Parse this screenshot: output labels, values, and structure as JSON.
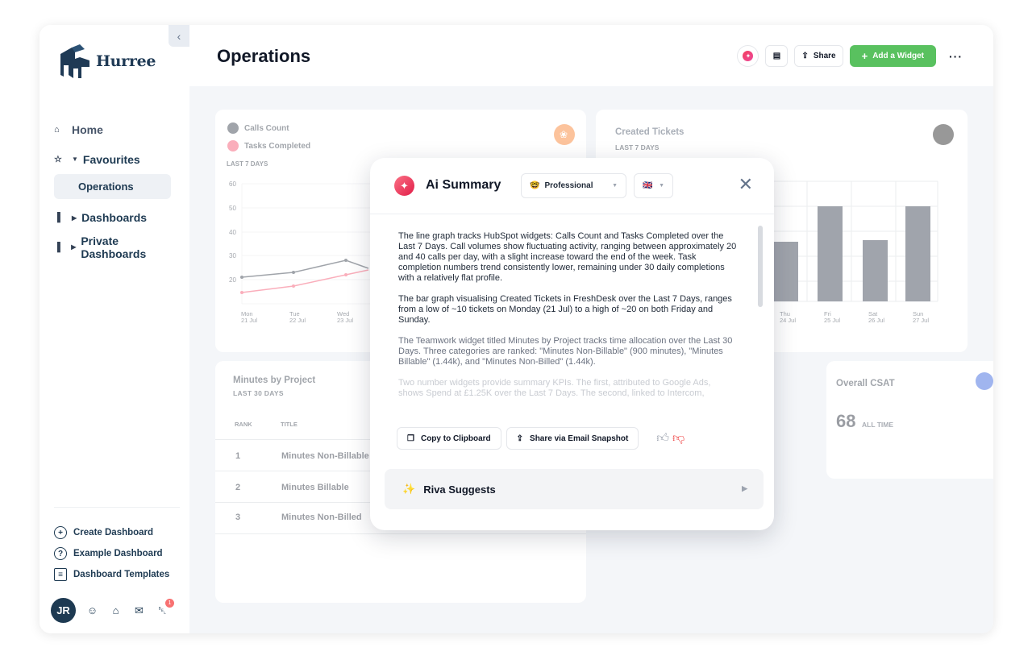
{
  "sidebar": {
    "logo_text": "Hurree",
    "nav": [
      {
        "label": "Home"
      },
      {
        "label": "Favourites"
      },
      {
        "label": "Operations"
      },
      {
        "label": "Dashboards"
      },
      {
        "label": "Private Dashboards"
      }
    ],
    "bottom_links": [
      "Create Dashboard",
      "Example Dashboard",
      "Dashboard Templates"
    ],
    "avatar_initials": "JR",
    "notification_count": "1"
  },
  "header": {
    "title": "Operations",
    "share_label": "Share",
    "add_widget_label": "Add a Widget",
    "more_label": "···"
  },
  "widgets": {
    "line": {
      "legend": [
        "Calls Count",
        "Tasks Completed"
      ],
      "sub": "LAST 7 DAYS",
      "yticks": [
        "60",
        "50",
        "40",
        "30",
        "20"
      ],
      "xticks": [
        {
          "d": "Mon",
          "n": "21 Jul"
        },
        {
          "d": "Tue",
          "n": "22 Jul"
        },
        {
          "d": "Wed",
          "n": "23 Jul"
        }
      ]
    },
    "bar": {
      "title": "Created Tickets",
      "sub": "LAST 7 DAYS",
      "xticks": [
        {
          "d": "Thu",
          "n": "24 Jul"
        },
        {
          "d": "Fri",
          "n": "25 Jul"
        },
        {
          "d": "Sat",
          "n": "26 Jul"
        },
        {
          "d": "Sun",
          "n": "27 Jul"
        }
      ]
    },
    "table": {
      "title": "Minutes by Project",
      "sub": "LAST 30 DAYS",
      "headers": [
        "RANK",
        "TITLE"
      ],
      "rows": [
        {
          "rank": "1",
          "title": "Minutes Non-Billable"
        },
        {
          "rank": "2",
          "title": "Minutes Billable"
        },
        {
          "rank": "3",
          "title": "Minutes Non-Billed"
        }
      ]
    },
    "csat": {
      "title": "Overall CSAT",
      "value": "68",
      "sub": "ALL TIME"
    }
  },
  "modal": {
    "title": "Ai Summary",
    "tone": "Professional",
    "tone_emoji": "🤓",
    "language_flag": "🇬🇧",
    "paragraphs": [
      "The line graph tracks HubSpot widgets: Calls Count and Tasks Completed over the Last 7 Days. Call volumes show fluctuating activity, ranging between approximately 20 and 40 calls per day, with a slight increase toward the end of the week. Task completion numbers trend consistently lower, remaining under 30 daily completions with a relatively flat profile.",
      "The bar graph visualising Created Tickets in FreshDesk over the Last 7 Days, ranges from a low of ~10 tickets on Monday (21 Jul) to a high of ~20 on both Friday and Sunday.",
      "The Teamwork widget titled Minutes by Project tracks time allocation over the Last 30 Days. Three categories are ranked: \"Minutes Non-Billable\" (900 minutes), \"Minutes Billable\" (1.44k), and \"Minutes Non-Billed\" (1.44k).",
      "Two number widgets provide summary KPIs. The first, attributed to Google Ads, shows Spend at £1.25K over the Last 7 Days. The second, linked to Intercom,"
    ],
    "copy_label": "Copy to Clipboard",
    "share_label": "Share via Email Snapshot",
    "riva_label": "Riva Suggests"
  },
  "colors": {
    "calls": "#6b7280",
    "tasks": "#f43f5e",
    "bars": "#1e293b",
    "accent_green": "#59c15f",
    "navy": "#1e3a52"
  }
}
